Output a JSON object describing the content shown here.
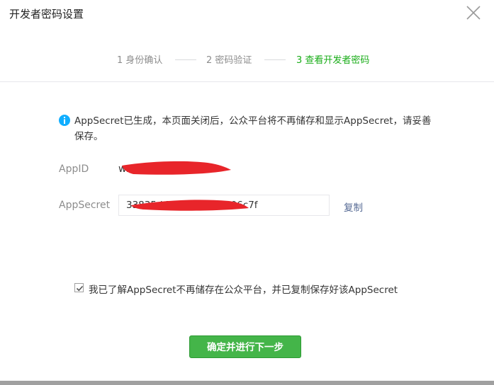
{
  "dialog": {
    "title": "开发者密码设置"
  },
  "steps": [
    {
      "label": "1 身份确认",
      "state": "done"
    },
    {
      "label": "2 密码验证",
      "state": "done"
    },
    {
      "label": "3 查看开发者密码",
      "state": "active"
    }
  ],
  "notice": {
    "text": "AppSecret已生成，本页面关闭后，公众平台将不再储存和显示AppSecret，请妥善保存。"
  },
  "fields": {
    "appid_label": "AppID",
    "appid_value": "wxb",
    "secret_label": "AppSecret",
    "secret_value": "33835d                              703766cab1c06c7f",
    "copy_label": "复制"
  },
  "confirm": {
    "checked": true,
    "text": "我已了解AppSecret不再储存在公众平台，并已复制保存好该AppSecret"
  },
  "actions": {
    "next_label": "确定并进行下一步"
  },
  "colors": {
    "accent": "#1aad19",
    "button": "#44b549",
    "link": "#576b95",
    "redaction": "#e8252a"
  }
}
